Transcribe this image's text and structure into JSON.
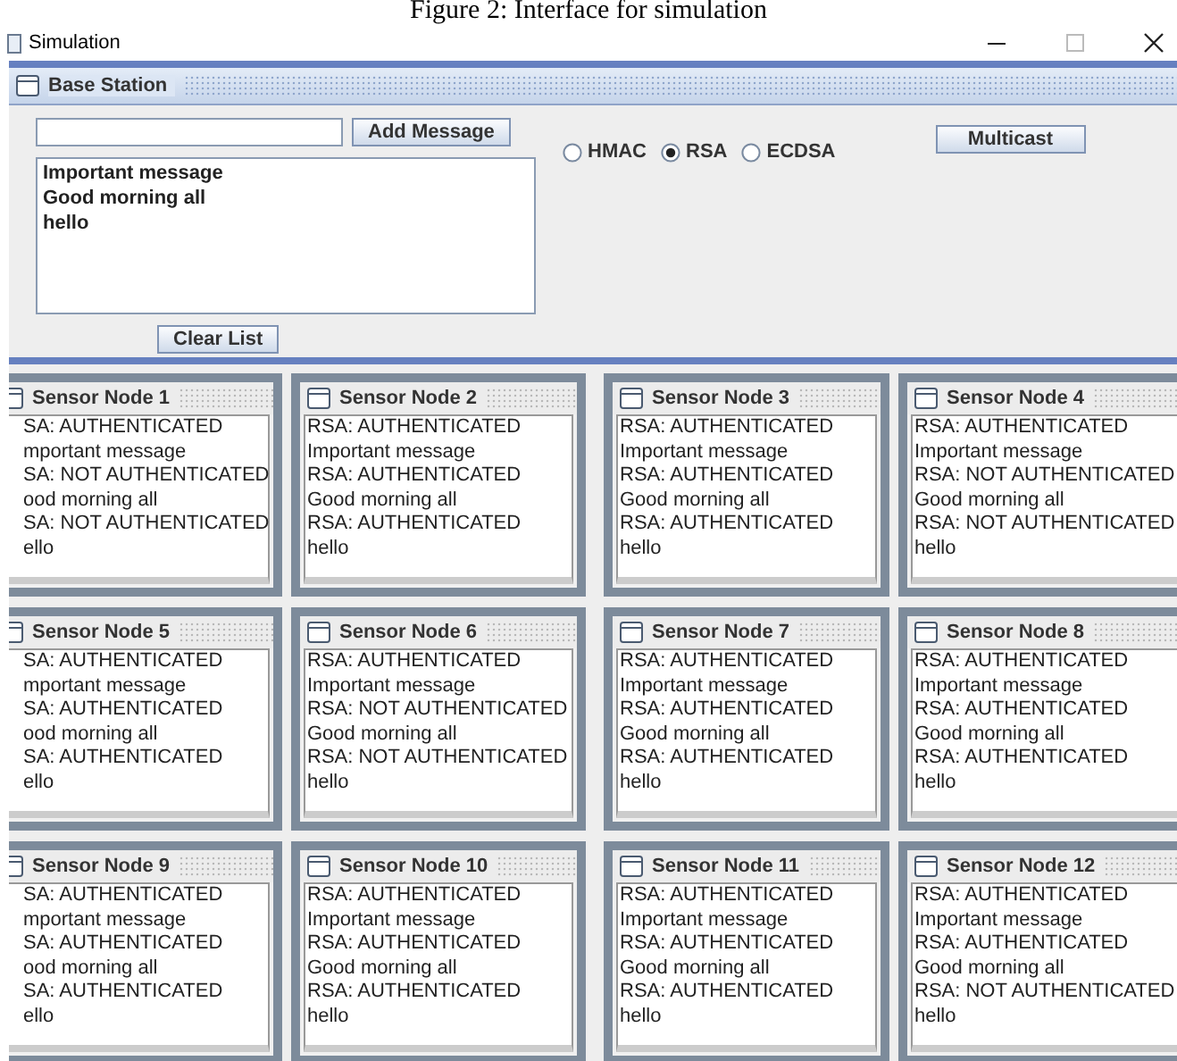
{
  "caption": "Figure 2: Interface for simulation",
  "window": {
    "title": "Simulation"
  },
  "base_station": {
    "title": "Base Station",
    "add_button": "Add Message",
    "messages": [
      "Important message",
      "Good morning all",
      "hello"
    ],
    "clear_button": "Clear List",
    "algorithms": [
      {
        "label": "HMAC",
        "selected": false
      },
      {
        "label": "RSA",
        "selected": true
      },
      {
        "label": "ECDSA",
        "selected": false
      }
    ],
    "multicast_button": "Multicast"
  },
  "nodes": [
    {
      "title": "Sensor Node 1",
      "lines": [
        "SA: AUTHENTICATED",
        "mportant message",
        "SA: NOT AUTHENTICATED",
        "ood morning all",
        "SA: NOT AUTHENTICATED",
        "ello"
      ]
    },
    {
      "title": "Sensor Node 2",
      "lines": [
        "RSA: AUTHENTICATED",
        "Important message",
        "RSA: AUTHENTICATED",
        "Good morning all",
        "RSA: AUTHENTICATED",
        "hello"
      ]
    },
    {
      "title": "Sensor Node 3",
      "lines": [
        "RSA: AUTHENTICATED",
        "Important message",
        "RSA: AUTHENTICATED",
        "Good morning all",
        "RSA: AUTHENTICATED",
        "hello"
      ]
    },
    {
      "title": "Sensor Node 4",
      "lines": [
        "RSA: AUTHENTICATED",
        "Important message",
        "RSA: NOT AUTHENTICATED",
        "Good morning all",
        "RSA: NOT AUTHENTICATED",
        "hello"
      ]
    },
    {
      "title": "Sensor Node 5",
      "lines": [
        "SA: AUTHENTICATED",
        "mportant message",
        "SA: AUTHENTICATED",
        "ood morning all",
        "SA: AUTHENTICATED",
        "ello"
      ]
    },
    {
      "title": "Sensor Node 6",
      "lines": [
        "RSA: AUTHENTICATED",
        "Important message",
        "RSA: NOT AUTHENTICATED",
        "Good morning all",
        "RSA: NOT AUTHENTICATED",
        "hello"
      ]
    },
    {
      "title": "Sensor Node 7",
      "lines": [
        "RSA: AUTHENTICATED",
        "Important message",
        "RSA: AUTHENTICATED",
        "Good morning all",
        "RSA: AUTHENTICATED",
        "hello"
      ]
    },
    {
      "title": "Sensor Node 8",
      "lines": [
        "RSA: AUTHENTICATED",
        "Important message",
        "RSA: AUTHENTICATED",
        "Good morning all",
        "RSA: AUTHENTICATED",
        "hello"
      ]
    },
    {
      "title": "Sensor Node 9",
      "lines": [
        "SA: AUTHENTICATED",
        "mportant message",
        "SA: AUTHENTICATED",
        "ood morning all",
        "SA: AUTHENTICATED",
        "ello"
      ]
    },
    {
      "title": "Sensor Node 10",
      "lines": [
        "RSA: AUTHENTICATED",
        "Important message",
        "RSA: AUTHENTICATED",
        "Good morning all",
        "RSA: AUTHENTICATED",
        "hello"
      ]
    },
    {
      "title": "Sensor Node 11",
      "lines": [
        "RSA: AUTHENTICATED",
        "Important message",
        "RSA: AUTHENTICATED",
        "Good morning all",
        "RSA: AUTHENTICATED",
        "hello"
      ]
    },
    {
      "title": "Sensor Node 12",
      "lines": [
        "RSA: AUTHENTICATED",
        "Important message",
        "RSA: AUTHENTICATED",
        "Good morning all",
        "RSA: NOT AUTHENTICATED",
        "hello"
      ]
    }
  ]
}
